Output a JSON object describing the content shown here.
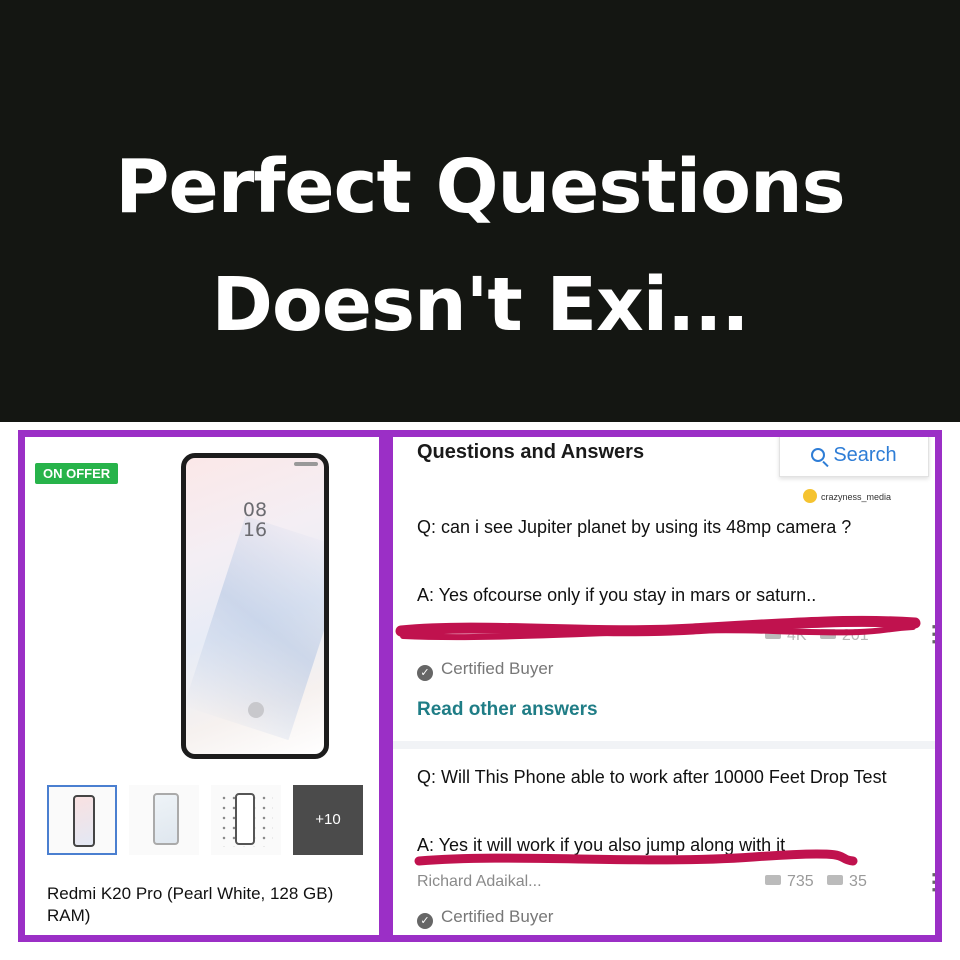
{
  "meme": {
    "title_line1": "Perfect Questions",
    "title_line2": "Doesn't Exi..."
  },
  "product": {
    "offer_badge": "ON OFFER",
    "phone_clock_hour": "08",
    "phone_clock_minute": "16",
    "thumbnail_more": "+10",
    "name": "Redmi K20 Pro (Pearl White, 128 GB) RAM)"
  },
  "qa": {
    "title": "Questions and Answers",
    "search_label": "Search",
    "watermark": "crazyness_media",
    "items": [
      {
        "question": "Q: can i see Jupiter planet by using its 48mp camera ?",
        "answer": "A: Yes ofcourse only if you stay in mars or saturn..",
        "certified": "Certified Buyer",
        "votes_up": "4K",
        "votes_down": "201"
      },
      {
        "question": "Q: Will This Phone able to work after 10000 Feet Drop Test",
        "answer": "A: Yes it will work if you also jump along with it",
        "author": "Richard Adaikal...",
        "votes_up": "735",
        "votes_down": "35",
        "certified": "Certified Buyer"
      }
    ],
    "read_other": "Read other answers"
  },
  "colors": {
    "frame": "#9b2fc6",
    "badge_green": "#27b34a",
    "scribble_red": "#c0124e",
    "link_blue": "#2e7dd6",
    "link_teal": "#1f7d86"
  }
}
